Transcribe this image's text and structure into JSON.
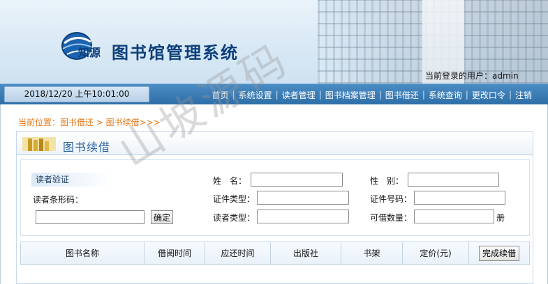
{
  "header": {
    "brand": "知源",
    "title": "图书馆管理系统",
    "login_user": "当前登录的用户：admin"
  },
  "nav": {
    "datetime": "2018/12/20 上午10:01:00",
    "items": [
      {
        "label": "首页"
      },
      {
        "label": "系统设置"
      },
      {
        "label": "读者管理"
      },
      {
        "label": "图书档案管理"
      },
      {
        "label": "图书借还"
      },
      {
        "label": "系统查询"
      },
      {
        "label": "更改口令"
      },
      {
        "label": "注销"
      }
    ],
    "separator": "|"
  },
  "breadcrumb": "当前位置：图书借还 > 图书续借>>>",
  "panel": {
    "title": "图书续借"
  },
  "verify": {
    "heading": "读者验证",
    "barcode_label": "读者条形码：",
    "barcode_value": "",
    "confirm_label": "确定",
    "name_label": "姓　名：",
    "gender_label": "性　别：",
    "id_type_label": "证件类型：",
    "id_number_label": "证件号码：",
    "reader_type_label": "读者类型：",
    "borrow_limit_label": "可借数量：",
    "borrow_unit": "册"
  },
  "table": {
    "columns": [
      "图书名称",
      "借阅时间",
      "应还时间",
      "出版社",
      "书架",
      "定价(元)"
    ],
    "action_label": "完成续借"
  },
  "watermark": "山坡源码",
  "colors": {
    "nav_bg": "#2f6fa8",
    "breadcrumb": "#e07a1a",
    "title_blue": "#0d3f7a"
  }
}
